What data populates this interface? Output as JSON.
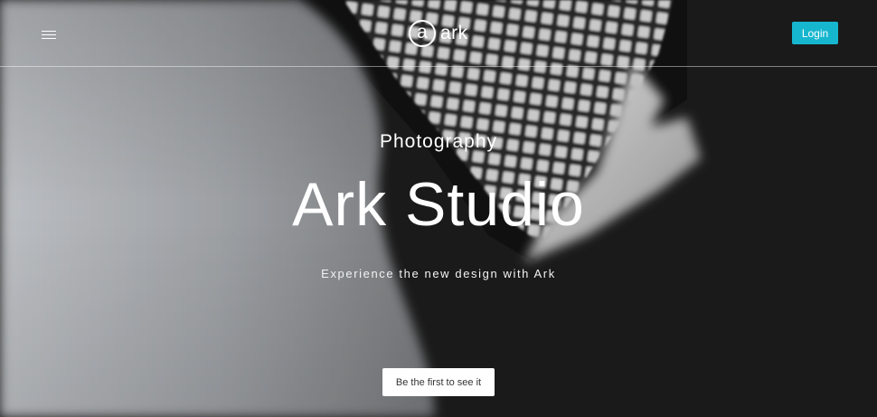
{
  "header": {
    "menu_icon": "hamburger-menu-icon",
    "logo": {
      "mark": "a",
      "text": "ark"
    },
    "login_label": "Login"
  },
  "hero": {
    "subtitle": "Photography",
    "title": "Ark Studio",
    "tagline": "Experience the new design with Ark",
    "cta_label": "Be the first to see it"
  },
  "colors": {
    "accent": "#17b6cf",
    "background": "#1c1c1c",
    "text": "#ffffff"
  }
}
